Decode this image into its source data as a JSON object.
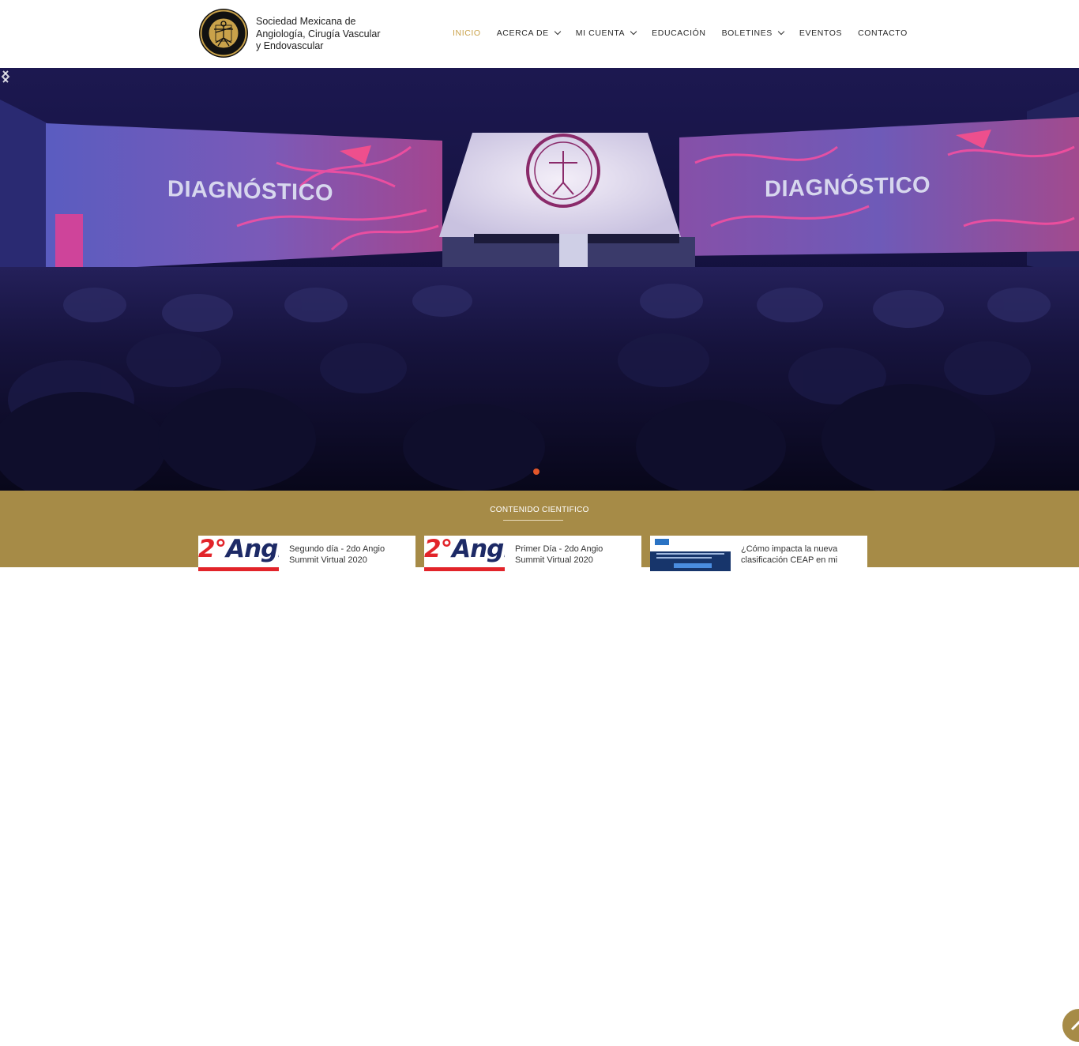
{
  "brand": {
    "lines": [
      "Sociedad Mexicana de",
      "Angiología, Cirugía Vascular",
      "y Endovascular"
    ],
    "logo_icon": "vitruvian-seal-logo"
  },
  "nav": {
    "items": [
      {
        "label": "INICIO",
        "active": true,
        "dropdown": false
      },
      {
        "label": "ACERCA DE",
        "active": false,
        "dropdown": true
      },
      {
        "label": "MI CUENTA",
        "active": false,
        "dropdown": true
      },
      {
        "label": "EDUCACIÓN",
        "active": false,
        "dropdown": false
      },
      {
        "label": "BOLETINES",
        "active": false,
        "dropdown": true
      },
      {
        "label": "EVENTOS",
        "active": false,
        "dropdown": false
      },
      {
        "label": "CONTACTO",
        "active": false,
        "dropdown": false
      }
    ],
    "active_color": "#c9a24a"
  },
  "hero": {
    "screen_left_text": "DIAGNÓSTICO",
    "screen_right_text": "DIAGNÓSTICO",
    "slide_dot_color": "#e2562a"
  },
  "science": {
    "title": "CONTENIDO CIENTIFICO",
    "background": "#a68b47",
    "cards": [
      {
        "title": "Segundo día - 2do Angio Summit Virtual 2020",
        "thumb_text_num": "2°",
        "thumb_text_word": "Angio"
      },
      {
        "title": "Primer Día - 2do Angio Summit Virtual 2020",
        "thumb_text_num": "2°",
        "thumb_text_word": "Angio"
      },
      {
        "title": "¿Cómo impacta la nueva clasificación CEAP en mi",
        "thumb_text_num": "",
        "thumb_text_word": ""
      }
    ]
  }
}
